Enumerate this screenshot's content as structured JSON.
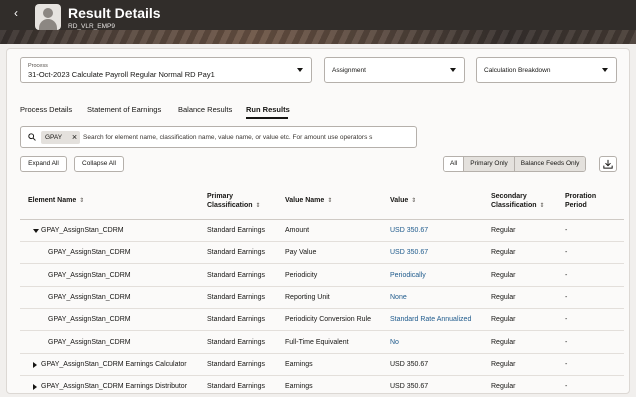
{
  "header": {
    "back_icon": "chevron-left-icon",
    "title": "Result Details",
    "subtitle": "RD_VLR_EMP9"
  },
  "filters": {
    "process": {
      "label": "Process",
      "value": "31-Oct-2023  Calculate Payroll  Regular Normal  RD Pay1"
    },
    "assignment": {
      "value": "Assignment"
    },
    "calculation": {
      "value": "Calculation Breakdown"
    }
  },
  "tabs": [
    {
      "label": "Process Details",
      "active": false
    },
    {
      "label": "Statement of Earnings",
      "active": false
    },
    {
      "label": "Balance Results",
      "active": false
    },
    {
      "label": "Run Results",
      "active": true
    }
  ],
  "search": {
    "chip": "GPAY",
    "placeholder": "Search for element name, classification name, value name, or value etc. For amount use operators s"
  },
  "actions": {
    "expand_all": "Expand All",
    "collapse_all": "Collapse All",
    "filter_all": "All",
    "filter_primary": "Primary Only",
    "filter_balance": "Balance Feeds Only",
    "download_icon": "download-icon"
  },
  "table": {
    "headers": {
      "element": "Element Name",
      "primary_1": "Primary",
      "primary_2": "Classification",
      "value_name": "Value Name",
      "value": "Value",
      "secondary_1": "Secondary",
      "secondary_2": "Classification",
      "proration_1": "Proration",
      "proration_2": "Period"
    },
    "rows": [
      {
        "element": "GPAY_AssignStan_CDRM",
        "primary": "Standard Earnings",
        "value_name": "Amount",
        "value": "USD 350.67",
        "secondary": "Regular",
        "proration": "-",
        "expander": "down",
        "link": true
      },
      {
        "element": "GPAY_AssignStan_CDRM",
        "primary": "Standard Earnings",
        "value_name": "Pay Value",
        "value": "USD 350.67",
        "secondary": "Regular",
        "proration": "-",
        "expander": "",
        "link": true
      },
      {
        "element": "GPAY_AssignStan_CDRM",
        "primary": "Standard Earnings",
        "value_name": "Periodicity",
        "value": "Periodically",
        "secondary": "Regular",
        "proration": "-",
        "expander": "",
        "link": true
      },
      {
        "element": "GPAY_AssignStan_CDRM",
        "primary": "Standard Earnings",
        "value_name": "Reporting Unit",
        "value": "None",
        "secondary": "Regular",
        "proration": "-",
        "expander": "",
        "link": true
      },
      {
        "element": "GPAY_AssignStan_CDRM",
        "primary": "Standard Earnings",
        "value_name": "Periodicity Conversion Rule",
        "value": "Standard Rate Annualized",
        "secondary": "Regular",
        "proration": "-",
        "expander": "",
        "link": true
      },
      {
        "element": "GPAY_AssignStan_CDRM",
        "primary": "Standard Earnings",
        "value_name": "Full-Time Equivalent",
        "value": "No",
        "secondary": "Regular",
        "proration": "-",
        "expander": "",
        "link": true
      },
      {
        "element": "GPAY_AssignStan_CDRM Earnings Calculator",
        "primary": "Standard Earnings",
        "value_name": "Earnings",
        "value": "USD 350.67",
        "secondary": "Regular",
        "proration": "-",
        "expander": "right",
        "link": false
      },
      {
        "element": "GPAY_AssignStan_CDRM Earnings Distributor",
        "primary": "Standard Earnings",
        "value_name": "Earnings",
        "value": "USD 350.67",
        "secondary": "Regular",
        "proration": "-",
        "expander": "right",
        "link": false
      }
    ]
  },
  "colors": {
    "header_bg": "#312d2a",
    "link": "#1e5a8c",
    "page_bg": "#f1efed"
  }
}
